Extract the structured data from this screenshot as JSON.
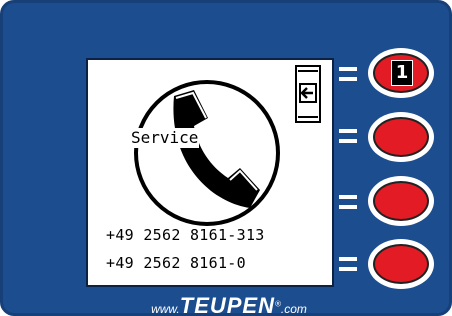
{
  "screen": {
    "service_label": "Service",
    "phone_numbers": [
      "+49 2562 8161-313",
      "+49 2562 8161-0"
    ],
    "back_icon": "arrow-left-icon"
  },
  "soft_keys": [
    {
      "number": "1",
      "color": "#e21b25"
    },
    {
      "number": "",
      "color": "#e21b25"
    },
    {
      "number": "",
      "color": "#e21b25"
    },
    {
      "number": "",
      "color": "#e21b25"
    }
  ],
  "brand": {
    "prefix": "www.",
    "name": "TEUPEN",
    "registered": "®",
    "suffix": ".com"
  },
  "colors": {
    "panel": "#1c4d8e",
    "key_red": "#e21b25",
    "screen": "#ffffff"
  }
}
